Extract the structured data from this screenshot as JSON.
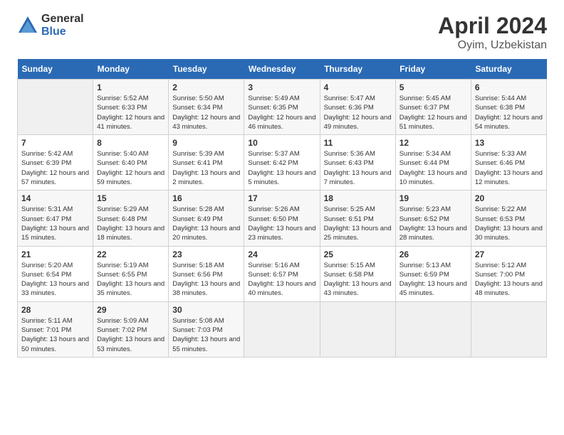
{
  "header": {
    "logo_general": "General",
    "logo_blue": "Blue",
    "month_title": "April 2024",
    "subtitle": "Oyim, Uzbekistan"
  },
  "calendar": {
    "weekdays": [
      "Sunday",
      "Monday",
      "Tuesday",
      "Wednesday",
      "Thursday",
      "Friday",
      "Saturday"
    ],
    "days": [
      {
        "date": "",
        "sunrise": "",
        "sunset": "",
        "daylight": ""
      },
      {
        "date": "1",
        "sunrise": "Sunrise: 5:52 AM",
        "sunset": "Sunset: 6:33 PM",
        "daylight": "Daylight: 12 hours and 41 minutes."
      },
      {
        "date": "2",
        "sunrise": "Sunrise: 5:50 AM",
        "sunset": "Sunset: 6:34 PM",
        "daylight": "Daylight: 12 hours and 43 minutes."
      },
      {
        "date": "3",
        "sunrise": "Sunrise: 5:49 AM",
        "sunset": "Sunset: 6:35 PM",
        "daylight": "Daylight: 12 hours and 46 minutes."
      },
      {
        "date": "4",
        "sunrise": "Sunrise: 5:47 AM",
        "sunset": "Sunset: 6:36 PM",
        "daylight": "Daylight: 12 hours and 49 minutes."
      },
      {
        "date": "5",
        "sunrise": "Sunrise: 5:45 AM",
        "sunset": "Sunset: 6:37 PM",
        "daylight": "Daylight: 12 hours and 51 minutes."
      },
      {
        "date": "6",
        "sunrise": "Sunrise: 5:44 AM",
        "sunset": "Sunset: 6:38 PM",
        "daylight": "Daylight: 12 hours and 54 minutes."
      },
      {
        "date": "7",
        "sunrise": "Sunrise: 5:42 AM",
        "sunset": "Sunset: 6:39 PM",
        "daylight": "Daylight: 12 hours and 57 minutes."
      },
      {
        "date": "8",
        "sunrise": "Sunrise: 5:40 AM",
        "sunset": "Sunset: 6:40 PM",
        "daylight": "Daylight: 12 hours and 59 minutes."
      },
      {
        "date": "9",
        "sunrise": "Sunrise: 5:39 AM",
        "sunset": "Sunset: 6:41 PM",
        "daylight": "Daylight: 13 hours and 2 minutes."
      },
      {
        "date": "10",
        "sunrise": "Sunrise: 5:37 AM",
        "sunset": "Sunset: 6:42 PM",
        "daylight": "Daylight: 13 hours and 5 minutes."
      },
      {
        "date": "11",
        "sunrise": "Sunrise: 5:36 AM",
        "sunset": "Sunset: 6:43 PM",
        "daylight": "Daylight: 13 hours and 7 minutes."
      },
      {
        "date": "12",
        "sunrise": "Sunrise: 5:34 AM",
        "sunset": "Sunset: 6:44 PM",
        "daylight": "Daylight: 13 hours and 10 minutes."
      },
      {
        "date": "13",
        "sunrise": "Sunrise: 5:33 AM",
        "sunset": "Sunset: 6:46 PM",
        "daylight": "Daylight: 13 hours and 12 minutes."
      },
      {
        "date": "14",
        "sunrise": "Sunrise: 5:31 AM",
        "sunset": "Sunset: 6:47 PM",
        "daylight": "Daylight: 13 hours and 15 minutes."
      },
      {
        "date": "15",
        "sunrise": "Sunrise: 5:29 AM",
        "sunset": "Sunset: 6:48 PM",
        "daylight": "Daylight: 13 hours and 18 minutes."
      },
      {
        "date": "16",
        "sunrise": "Sunrise: 5:28 AM",
        "sunset": "Sunset: 6:49 PM",
        "daylight": "Daylight: 13 hours and 20 minutes."
      },
      {
        "date": "17",
        "sunrise": "Sunrise: 5:26 AM",
        "sunset": "Sunset: 6:50 PM",
        "daylight": "Daylight: 13 hours and 23 minutes."
      },
      {
        "date": "18",
        "sunrise": "Sunrise: 5:25 AM",
        "sunset": "Sunset: 6:51 PM",
        "daylight": "Daylight: 13 hours and 25 minutes."
      },
      {
        "date": "19",
        "sunrise": "Sunrise: 5:23 AM",
        "sunset": "Sunset: 6:52 PM",
        "daylight": "Daylight: 13 hours and 28 minutes."
      },
      {
        "date": "20",
        "sunrise": "Sunrise: 5:22 AM",
        "sunset": "Sunset: 6:53 PM",
        "daylight": "Daylight: 13 hours and 30 minutes."
      },
      {
        "date": "21",
        "sunrise": "Sunrise: 5:20 AM",
        "sunset": "Sunset: 6:54 PM",
        "daylight": "Daylight: 13 hours and 33 minutes."
      },
      {
        "date": "22",
        "sunrise": "Sunrise: 5:19 AM",
        "sunset": "Sunset: 6:55 PM",
        "daylight": "Daylight: 13 hours and 35 minutes."
      },
      {
        "date": "23",
        "sunrise": "Sunrise: 5:18 AM",
        "sunset": "Sunset: 6:56 PM",
        "daylight": "Daylight: 13 hours and 38 minutes."
      },
      {
        "date": "24",
        "sunrise": "Sunrise: 5:16 AM",
        "sunset": "Sunset: 6:57 PM",
        "daylight": "Daylight: 13 hours and 40 minutes."
      },
      {
        "date": "25",
        "sunrise": "Sunrise: 5:15 AM",
        "sunset": "Sunset: 6:58 PM",
        "daylight": "Daylight: 13 hours and 43 minutes."
      },
      {
        "date": "26",
        "sunrise": "Sunrise: 5:13 AM",
        "sunset": "Sunset: 6:59 PM",
        "daylight": "Daylight: 13 hours and 45 minutes."
      },
      {
        "date": "27",
        "sunrise": "Sunrise: 5:12 AM",
        "sunset": "Sunset: 7:00 PM",
        "daylight": "Daylight: 13 hours and 48 minutes."
      },
      {
        "date": "28",
        "sunrise": "Sunrise: 5:11 AM",
        "sunset": "Sunset: 7:01 PM",
        "daylight": "Daylight: 13 hours and 50 minutes."
      },
      {
        "date": "29",
        "sunrise": "Sunrise: 5:09 AM",
        "sunset": "Sunset: 7:02 PM",
        "daylight": "Daylight: 13 hours and 53 minutes."
      },
      {
        "date": "30",
        "sunrise": "Sunrise: 5:08 AM",
        "sunset": "Sunset: 7:03 PM",
        "daylight": "Daylight: 13 hours and 55 minutes."
      },
      {
        "date": "",
        "sunrise": "",
        "sunset": "",
        "daylight": ""
      },
      {
        "date": "",
        "sunrise": "",
        "sunset": "",
        "daylight": ""
      },
      {
        "date": "",
        "sunrise": "",
        "sunset": "",
        "daylight": ""
      },
      {
        "date": "",
        "sunrise": "",
        "sunset": "",
        "daylight": ""
      }
    ]
  }
}
